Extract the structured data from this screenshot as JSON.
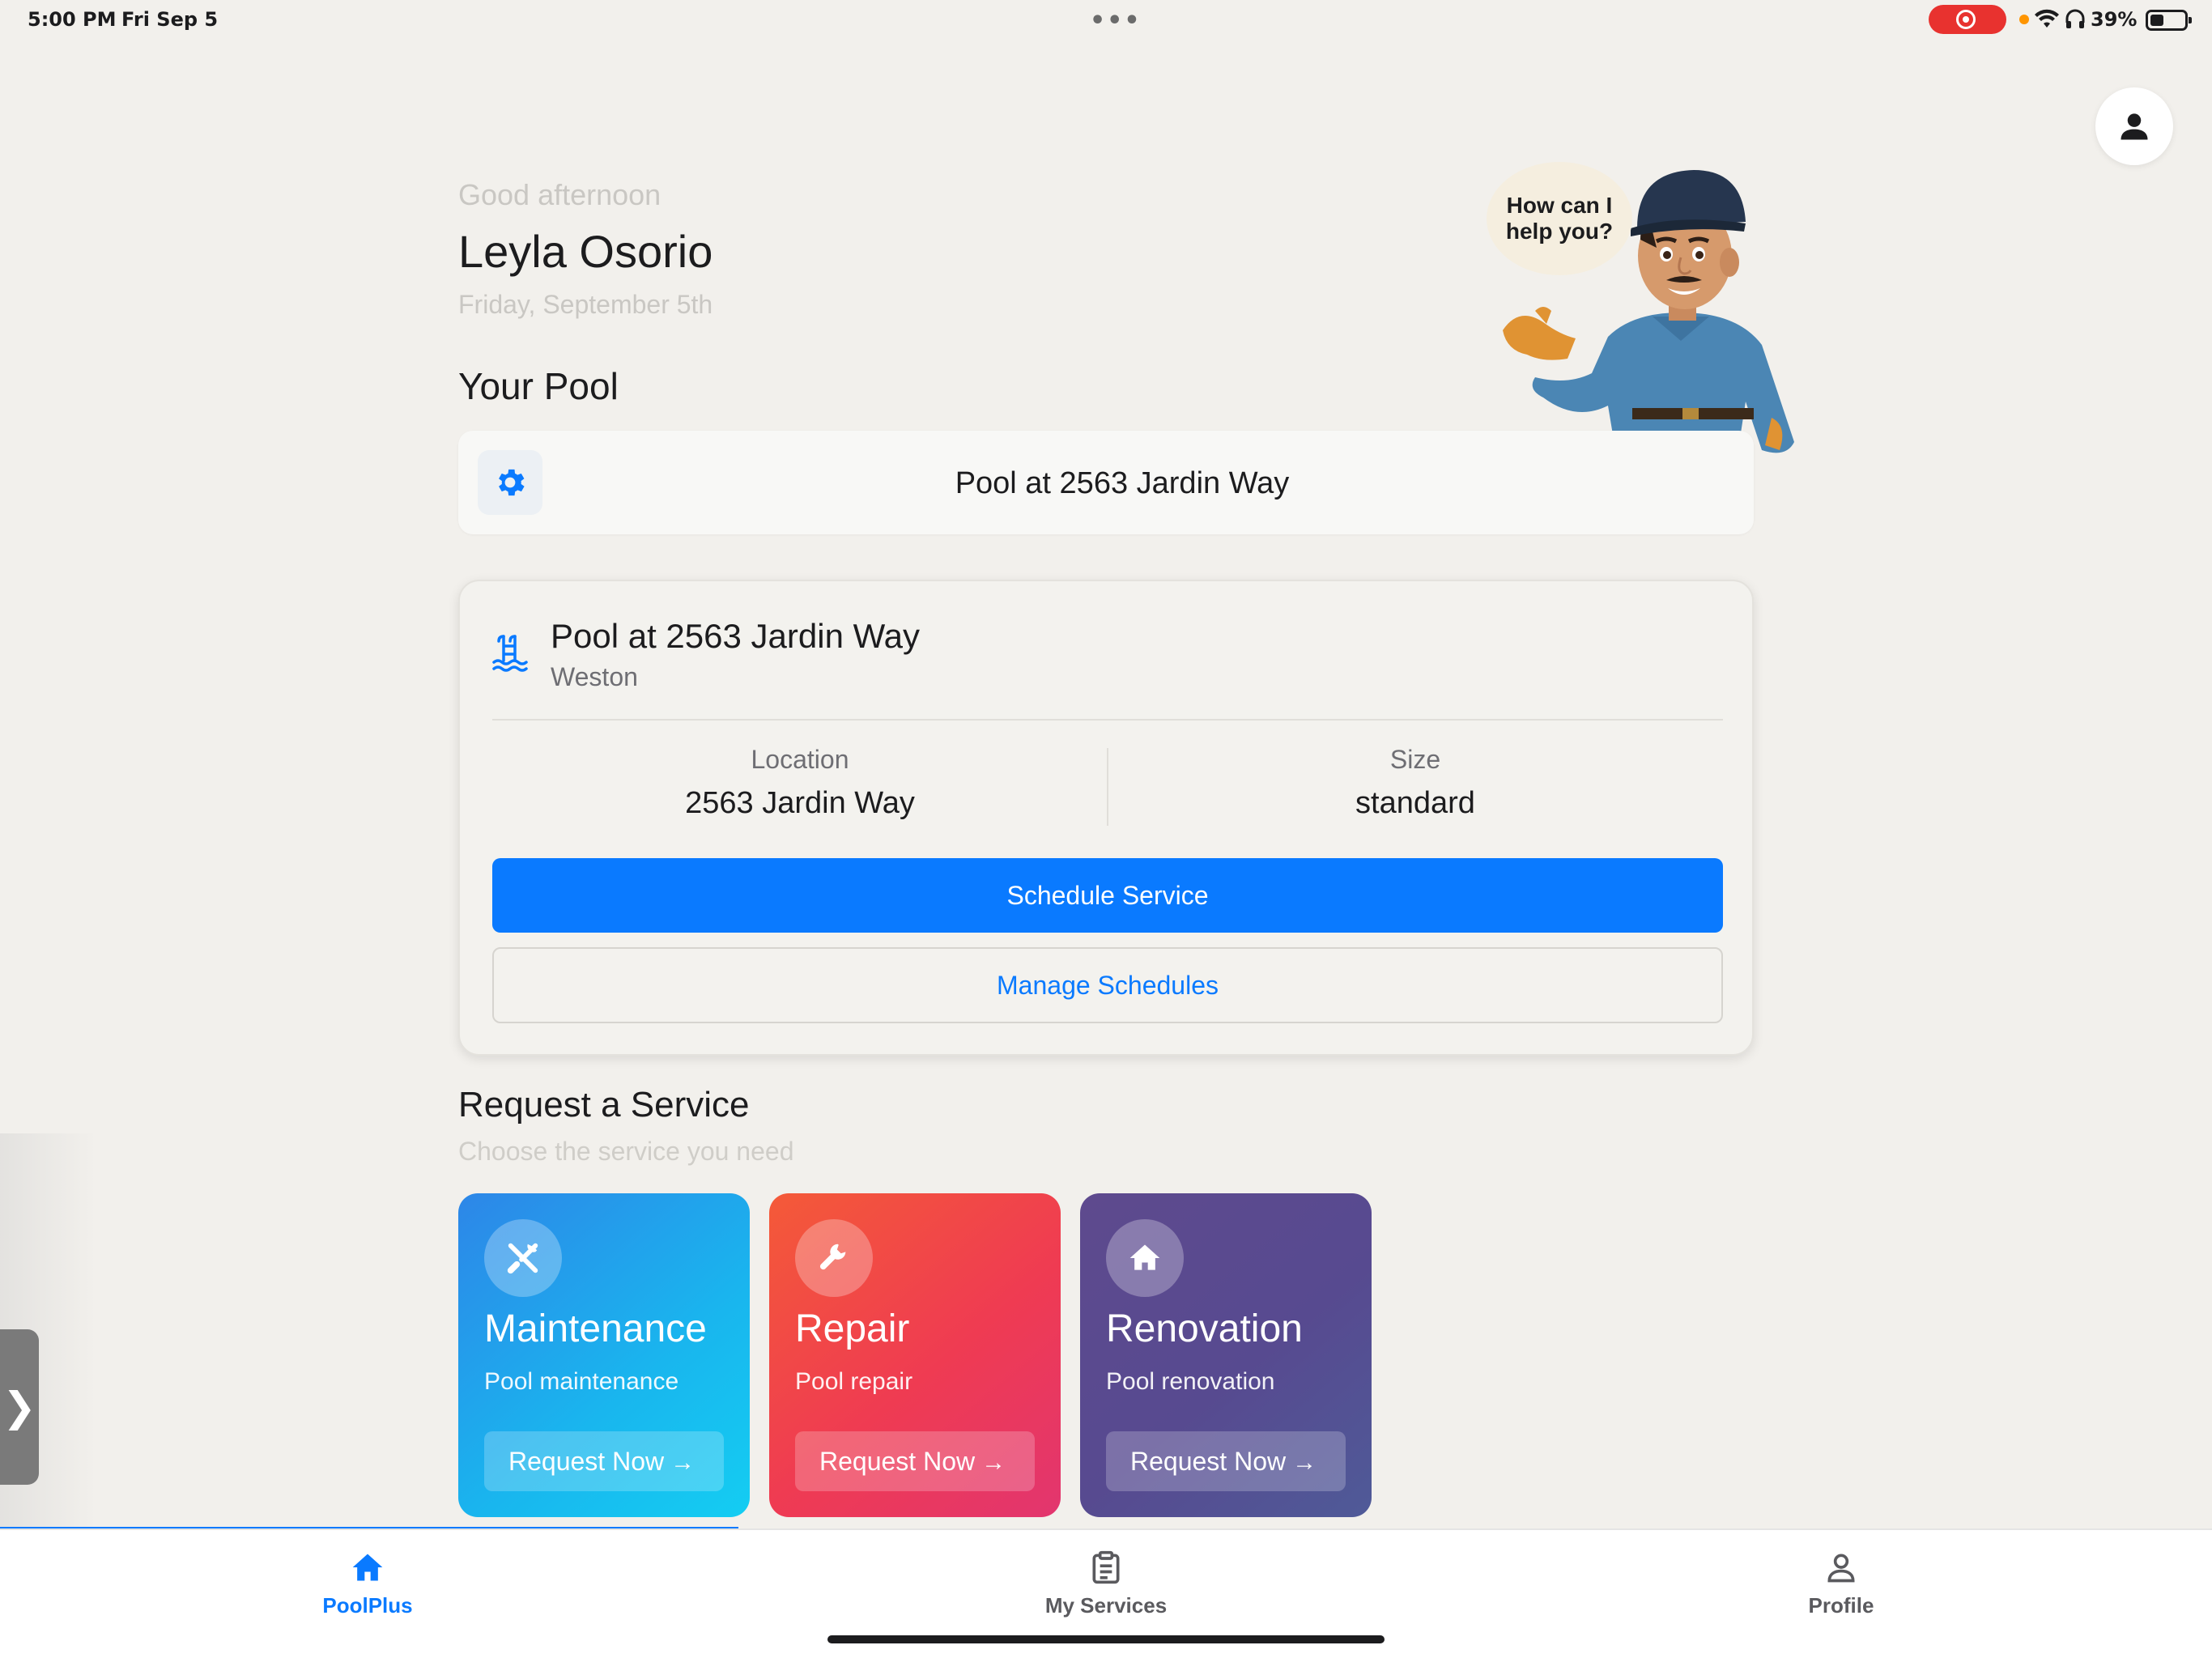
{
  "status_bar": {
    "time": "5:00 PM",
    "date": "Fri Sep 5",
    "battery_percent": "39%",
    "dots": "•••"
  },
  "header": {
    "greeting": "Good afternoon",
    "user_name": "Leyla Osorio",
    "date": "Friday, September 5th",
    "mascot_speech": "How can I help you?"
  },
  "your_pool": {
    "section_title": "Your Pool",
    "selected_pool": "Pool at 2563 Jardin Way"
  },
  "pool_card": {
    "title": "Pool at 2563 Jardin Way",
    "subtitle": "Weston",
    "location_label": "Location",
    "location_value": "2563 Jardin Way",
    "size_label": "Size",
    "size_value": "standard",
    "schedule_button": "Schedule Service",
    "manage_button": "Manage Schedules"
  },
  "request_service": {
    "title": "Request a Service",
    "subtitle": "Choose the service you need",
    "cards": [
      {
        "title": "Maintenance",
        "subtitle": "Pool maintenance",
        "button": "Request Now",
        "icon": "tools-icon"
      },
      {
        "title": "Repair",
        "subtitle": "Pool repair",
        "button": "Request Now",
        "icon": "wrench-icon"
      },
      {
        "title": "Renovation",
        "subtitle": "Pool renovation",
        "button": "Request Now",
        "icon": "home-icon"
      }
    ]
  },
  "tab_bar": {
    "tabs": [
      {
        "label": "PoolPlus",
        "icon": "home-icon",
        "active": true
      },
      {
        "label": "My Services",
        "icon": "clipboard-icon",
        "active": false
      },
      {
        "label": "Profile",
        "icon": "person-icon",
        "active": false
      }
    ]
  },
  "colors": {
    "accent": "#0a7aff",
    "background": "#f2f0ec",
    "maintenance_gradient": [
      "#2d86e8",
      "#14cdf2"
    ],
    "repair_gradient": [
      "#f45a38",
      "#e2356f"
    ],
    "renovation_gradient": [
      "#5e4a8e",
      "#4f5a98"
    ]
  }
}
